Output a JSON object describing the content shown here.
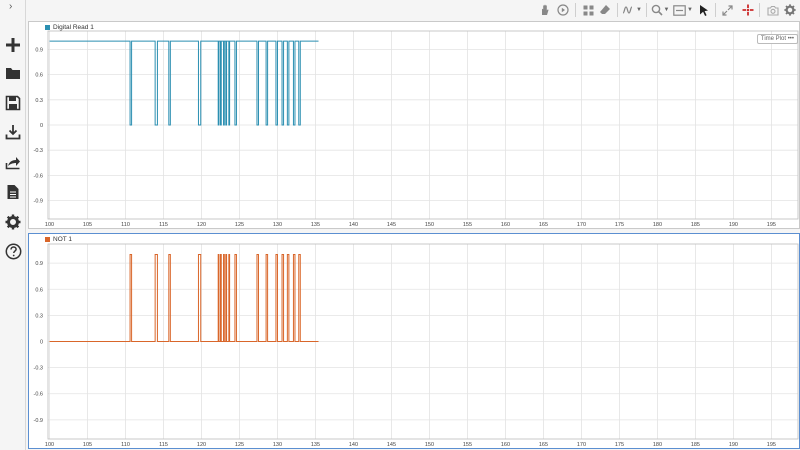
{
  "toolbar": {
    "icons": [
      "hand-icon",
      "play-icon",
      "layout-icon",
      "eraser-icon",
      "signal-icon",
      "zoom-icon",
      "fit-icon",
      "cursor-icon",
      "expand-icon",
      "target-icon",
      "camera-icon",
      "gear-icon"
    ]
  },
  "sidebar": {
    "icons": [
      "plus-icon",
      "folder-icon",
      "save-icon",
      "download-icon",
      "share-icon",
      "document-icon",
      "gear-icon",
      "help-icon"
    ]
  },
  "panels": [
    {
      "legend": "Digital Read 1",
      "badge": "Time Plot •••",
      "color": "#2b8fb1"
    },
    {
      "legend": "NOT 1",
      "badge": "",
      "color": "#d9662a"
    }
  ],
  "chart_data": [
    {
      "type": "line",
      "series": [
        {
          "name": "Digital Read 1",
          "color": "#2b8fb1",
          "x": [
            100,
            110.6,
            110.6,
            110.8,
            110.8,
            113.9,
            113.9,
            114.2,
            114.2,
            115.7,
            115.7,
            115.9,
            115.9,
            119.6,
            119.6,
            119.9,
            119.9,
            122.2,
            122.2,
            122.3,
            122.3,
            122.5,
            122.5,
            122.6,
            122.6,
            122.9,
            122.9,
            123.0,
            123.0,
            123.2,
            123.2,
            123.3,
            123.3,
            123.6,
            123.6,
            123.7,
            123.7,
            124.4,
            124.4,
            124.6,
            124.6,
            127.3,
            127.3,
            127.5,
            127.5,
            128.5,
            128.5,
            128.7,
            128.7,
            129.8,
            129.8,
            130.0,
            130.0,
            130.6,
            130.6,
            130.8,
            130.8,
            131.3,
            131.3,
            131.5,
            131.5,
            132.1,
            132.1,
            132.3,
            132.3,
            132.8,
            132.8,
            133.0,
            133.0,
            135.4
          ],
          "y": [
            1,
            1,
            0,
            0,
            1,
            1,
            0,
            0,
            1,
            1,
            0,
            0,
            1,
            1,
            0,
            0,
            1,
            1,
            0,
            0,
            1,
            1,
            0,
            0,
            1,
            1,
            0,
            0,
            1,
            1,
            0,
            0,
            1,
            1,
            0,
            0,
            1,
            1,
            0,
            0,
            1,
            1,
            0,
            0,
            1,
            1,
            0,
            0,
            1,
            1,
            0,
            0,
            1,
            1,
            0,
            0,
            1,
            1,
            0,
            0,
            1,
            1,
            0,
            0,
            1,
            1,
            0,
            0,
            1,
            1
          ]
        }
      ],
      "xlim": [
        99.8,
        198.5
      ],
      "ylim": [
        -1.12,
        1.12
      ],
      "xticks": [
        100,
        105,
        110,
        115,
        120,
        125,
        130,
        135,
        140,
        145,
        150,
        155,
        160,
        165,
        170,
        175,
        180,
        185,
        190,
        195
      ],
      "yticks": [
        0.9,
        0.6,
        0.3,
        0,
        -0.3,
        -0.6,
        -0.9
      ],
      "grid": true,
      "legend_position": "top-left"
    },
    {
      "type": "line",
      "series": [
        {
          "name": "NOT 1",
          "color": "#d9662a",
          "x": [
            100,
            110.6,
            110.6,
            110.8,
            110.8,
            113.9,
            113.9,
            114.2,
            114.2,
            115.7,
            115.7,
            115.9,
            115.9,
            119.6,
            119.6,
            119.9,
            119.9,
            122.2,
            122.2,
            122.3,
            122.3,
            122.5,
            122.5,
            122.6,
            122.6,
            122.9,
            122.9,
            123.0,
            123.0,
            123.2,
            123.2,
            123.3,
            123.3,
            123.6,
            123.6,
            123.7,
            123.7,
            124.4,
            124.4,
            124.6,
            124.6,
            127.3,
            127.3,
            127.5,
            127.5,
            128.5,
            128.5,
            128.7,
            128.7,
            129.8,
            129.8,
            130.0,
            130.0,
            130.6,
            130.6,
            130.8,
            130.8,
            131.3,
            131.3,
            131.5,
            131.5,
            132.1,
            132.1,
            132.3,
            132.3,
            132.8,
            132.8,
            133.0,
            133.0,
            135.4
          ],
          "y": [
            0,
            0,
            1,
            1,
            0,
            0,
            1,
            1,
            0,
            0,
            1,
            1,
            0,
            0,
            1,
            1,
            0,
            0,
            1,
            1,
            0,
            0,
            1,
            1,
            0,
            0,
            1,
            1,
            0,
            0,
            1,
            1,
            0,
            0,
            1,
            1,
            0,
            0,
            1,
            1,
            0,
            0,
            1,
            1,
            0,
            0,
            1,
            1,
            0,
            0,
            1,
            1,
            0,
            0,
            1,
            1,
            0,
            0,
            1,
            1,
            0,
            0,
            1,
            1,
            0,
            0,
            1,
            1,
            0,
            0
          ]
        }
      ],
      "xlim": [
        99.8,
        198.5
      ],
      "ylim": [
        -1.12,
        1.12
      ],
      "xticks": [
        100,
        105,
        110,
        115,
        120,
        125,
        130,
        135,
        140,
        145,
        150,
        155,
        160,
        165,
        170,
        175,
        180,
        185,
        190,
        195
      ],
      "yticks": [
        0.9,
        0.6,
        0.3,
        0,
        -0.3,
        -0.6,
        -0.9
      ],
      "grid": true,
      "legend_position": "top-left"
    }
  ]
}
